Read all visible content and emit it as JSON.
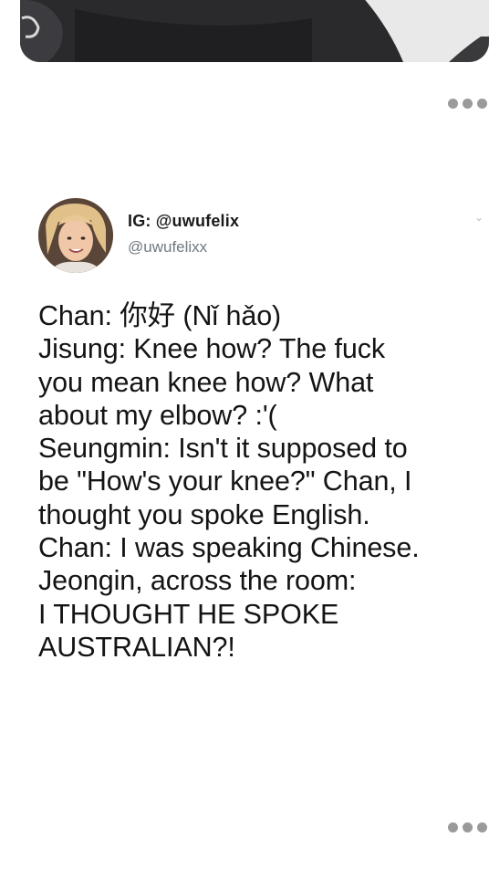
{
  "menu": {
    "more_icon": "more-horizontal-icon"
  },
  "tweet": {
    "display_name": "IG: @uwufelix",
    "handle": "@uwufelixx",
    "body_lines": [
      "Chan: 你好 (Nǐ hǎo)",
      "Jisung: Knee how? The fuck",
      "you mean knee how? What",
      "about my elbow? :'(",
      "Seungmin: Isn't it supposed to",
      "be \"How's your knee?\" Chan, I",
      "thought you spoke English.",
      "Chan: I was speaking Chinese.",
      "Jeongin, across the room:",
      "I THOUGHT HE SPOKE",
      "AUSTRALIAN?!"
    ]
  },
  "colors": {
    "text": "#141414",
    "handle": "#707980",
    "dots": "#9a9a9a",
    "background": "#ffffff"
  }
}
